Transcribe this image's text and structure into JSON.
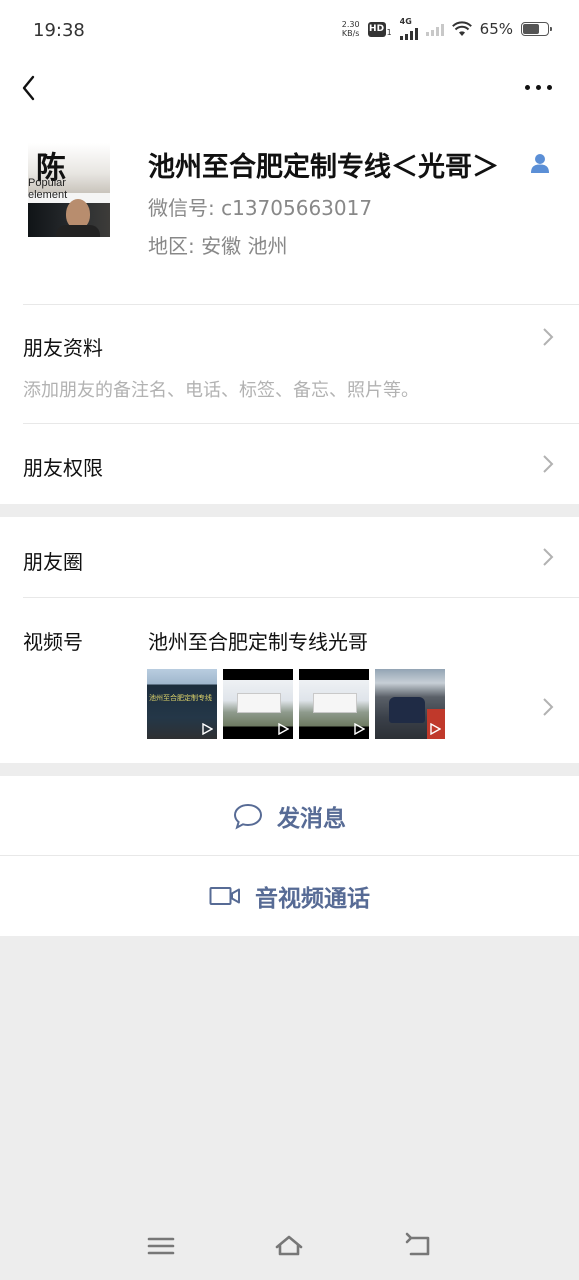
{
  "status_bar": {
    "time": "19:38",
    "net_speed_value": "2.30",
    "net_speed_unit": "KB/s",
    "hd_label": "HD",
    "hd_sub": "1",
    "network_type": "4G",
    "battery_percent": "65%"
  },
  "profile": {
    "name": "池州至合肥定制专线＜光哥＞",
    "wechat_id": "微信号:  c13705663017",
    "region": "地区:  安徽  池州",
    "avatar_char": "陈",
    "avatar_text_line1": "Popular",
    "avatar_text_line2": "element"
  },
  "rows": {
    "friend_info_title": "朋友资料",
    "friend_info_sub": "添加朋友的备注名、电话、标签、备忘、照片等。",
    "friend_permissions_title": "朋友权限",
    "moments_title": "朋友圈",
    "channels_title": "视频号",
    "channels_name": "池州至合肥定制专线光哥"
  },
  "thumbnails": [
    {
      "icon": "play-icon"
    },
    {
      "icon": "play-icon"
    },
    {
      "icon": "play-icon"
    },
    {
      "icon": "play-icon"
    }
  ],
  "actions": {
    "send_message": "发消息",
    "video_call": "音视频通话"
  },
  "colors": {
    "link_blue": "#576b95",
    "background": "#ededed",
    "card": "#ffffff"
  }
}
